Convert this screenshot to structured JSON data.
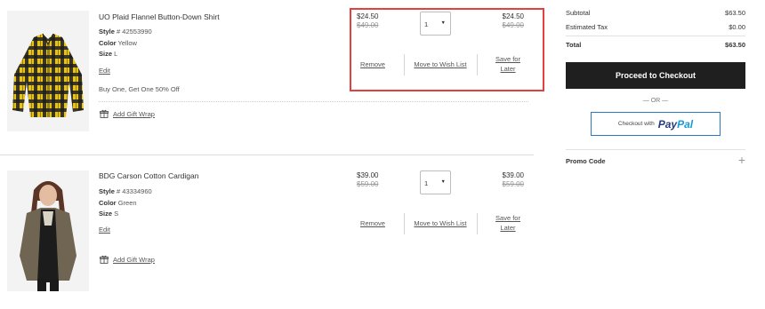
{
  "cart": {
    "items": [
      {
        "title": "UO Plaid Flannel Button-Down Shirt",
        "style_label": "Style",
        "style_value": "# 42553990",
        "color_label": "Color",
        "color_value": "Yellow",
        "size_label": "Size",
        "size_value": "L",
        "edit_label": "Edit",
        "promo": "Buy One, Get One 50% Off",
        "gift_wrap_label": "Add Gift Wrap",
        "unit_price": "$24.50",
        "unit_price_original": "$49.00",
        "quantity": "1",
        "line_price": "$24.50",
        "line_price_original": "$49.00",
        "remove_label": "Remove",
        "wishlist_label": "Move to Wish List",
        "save_label_1": "Save for",
        "save_label_2": "Later"
      },
      {
        "title": "BDG Carson Cotton Cardigan",
        "style_label": "Style",
        "style_value": "# 43334960",
        "color_label": "Color",
        "color_value": "Green",
        "size_label": "Size",
        "size_value": "S",
        "edit_label": "Edit",
        "gift_wrap_label": "Add Gift Wrap",
        "unit_price": "$39.00",
        "unit_price_original": "$59.00",
        "quantity": "1",
        "line_price": "$39.00",
        "line_price_original": "$59.00",
        "remove_label": "Remove",
        "wishlist_label": "Move to Wish List",
        "save_label_1": "Save for",
        "save_label_2": "Later"
      }
    ]
  },
  "summary": {
    "subtotal_label": "Subtotal",
    "subtotal_value": "$63.50",
    "tax_label": "Estimated Tax",
    "tax_value": "$0.00",
    "total_label": "Total",
    "total_value": "$63.50",
    "checkout_label": "Proceed to Checkout",
    "or_label": "— OR —",
    "paypal_prefix": "Checkout with",
    "paypal_logo_a": "Pay",
    "paypal_logo_b": "Pal",
    "promo_label": "Promo Code",
    "promo_toggle": "+"
  },
  "colors": {
    "highlight": "#e34040",
    "checkout_bg": "#1f1f1f",
    "paypal_border": "#2b78c2",
    "paypal_dark": "#253b80",
    "paypal_light": "#179bd7"
  },
  "icons": {
    "gift": "gift-icon",
    "caret": "chevron-down-icon",
    "plus": "plus-icon"
  }
}
